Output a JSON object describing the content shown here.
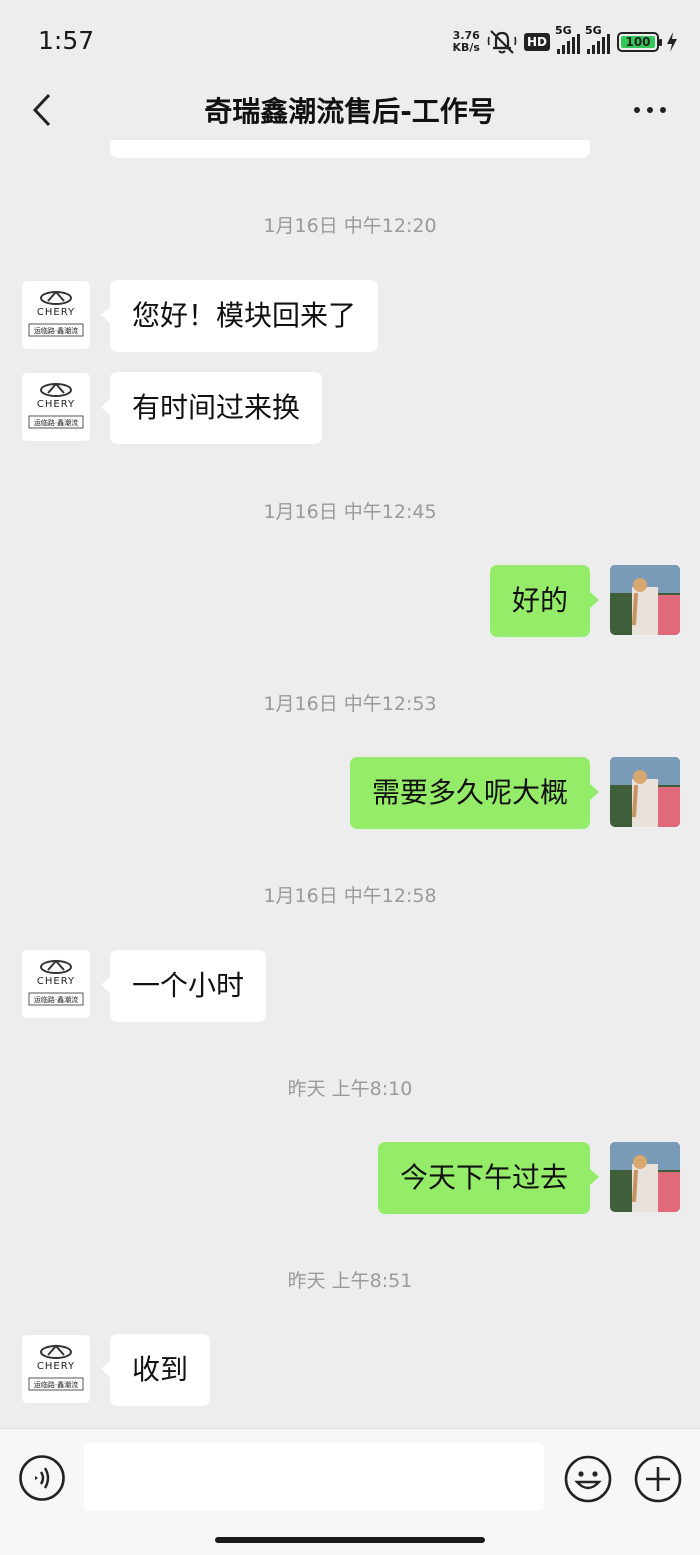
{
  "status_bar": {
    "time": "1:57",
    "net_speed_value": "3.76",
    "net_speed_unit": "KB/s",
    "hd_label": "HD",
    "network_1": "5G",
    "network_2": "5G",
    "battery": "100",
    "icons": [
      "mute-bell-icon",
      "hd-icon",
      "signal-icon",
      "signal-icon",
      "battery-icon",
      "charging-icon"
    ]
  },
  "header": {
    "title": "奇瑞鑫潮流售后-工作号",
    "back_icon": "chevron-left-icon",
    "more_icon": "more-dots-icon"
  },
  "avatars": {
    "contact_brand": "CHERY",
    "contact_sub": "运临路·鑫潮流"
  },
  "messages": [
    {
      "type": "timestamp",
      "text": "1月16日 中午12:20"
    },
    {
      "type": "incoming",
      "text": "您好！模块回来了"
    },
    {
      "type": "incoming",
      "text": "有时间过来换"
    },
    {
      "type": "timestamp",
      "text": "1月16日 中午12:45"
    },
    {
      "type": "outgoing",
      "text": "好的"
    },
    {
      "type": "timestamp",
      "text": "1月16日 中午12:53"
    },
    {
      "type": "outgoing",
      "text": "需要多久呢大概"
    },
    {
      "type": "timestamp",
      "text": "1月16日 中午12:58"
    },
    {
      "type": "incoming",
      "text": "一个小时"
    },
    {
      "type": "timestamp",
      "text": "昨天 上午8:10"
    },
    {
      "type": "outgoing",
      "text": "今天下午过去"
    },
    {
      "type": "timestamp",
      "text": "昨天 上午8:51"
    },
    {
      "type": "incoming",
      "text": "收到"
    }
  ],
  "input_bar": {
    "placeholder": "",
    "icons": [
      "voice-icon",
      "emoji-icon",
      "plus-icon"
    ]
  },
  "colors": {
    "background": "#ededed",
    "outgoing_bubble": "#95ec69",
    "incoming_bubble": "#ffffff",
    "timestamp_text": "#9a9a9a"
  }
}
